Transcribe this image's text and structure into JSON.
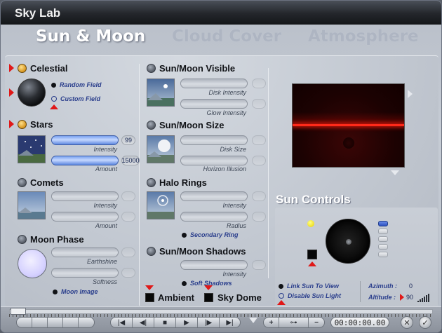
{
  "window": {
    "title": "Sky Lab"
  },
  "tabs": [
    {
      "label": "Sun & Moon",
      "active": true
    },
    {
      "label": "Cloud Cover",
      "active": false
    },
    {
      "label": "Atmosphere",
      "active": false
    }
  ],
  "left": {
    "celestial": {
      "label": "Celestial",
      "random_field": "Random Field",
      "custom_field": "Custom Field"
    },
    "stars": {
      "label": "Stars",
      "intensity_label": "Intensity",
      "intensity_value": "99",
      "amount_label": "Amount",
      "amount_value": "15000"
    },
    "comets": {
      "label": "Comets",
      "intensity_label": "Intensity",
      "amount_label": "Amount"
    },
    "moon_phase": {
      "label": "Moon Phase",
      "earthshine_label": "Earthshine",
      "softness_label": "Softness",
      "moon_image": "Moon Image"
    }
  },
  "middle": {
    "visible": {
      "label": "Sun/Moon Visible",
      "disk_intensity": "Disk Intensity",
      "glow_intensity": "Glow Intensity"
    },
    "size": {
      "label": "Sun/Moon Size",
      "disk_size": "Disk Size",
      "horizon_illusion": "Horizon Illusion"
    },
    "halo": {
      "label": "Halo Rings",
      "intensity_label": "Intensity",
      "radius_label": "Radius",
      "secondary_ring": "Secondary Ring"
    },
    "shadows": {
      "label": "Sun/Moon Shadows",
      "intensity_label": "Intensity",
      "soft_shadows": "Soft Shadows"
    },
    "ambient": "Ambient",
    "sky_dome": "Sky Dome"
  },
  "sun_controls": {
    "title": "Sun Controls",
    "link_sun": "Link Sun To View",
    "disable_sun_light": "Disable Sun Light",
    "azimuth_label": "Azimuth :",
    "azimuth_value": "0",
    "altitude_label": "Altitude :",
    "altitude_value": "90"
  },
  "transport": {
    "time": "00:00:00.00",
    "plus": "+",
    "minus": "−",
    "key": "⊶",
    "close": "✕",
    "ok": "✓",
    "buttons": [
      "|◀",
      "◀|",
      "■",
      "▶",
      "|▶",
      "▶|"
    ]
  },
  "colors": {
    "accent_red": "#e01818",
    "preview_horizon": "#ff2a1a",
    "slider_blue": "#7aa2f0"
  }
}
